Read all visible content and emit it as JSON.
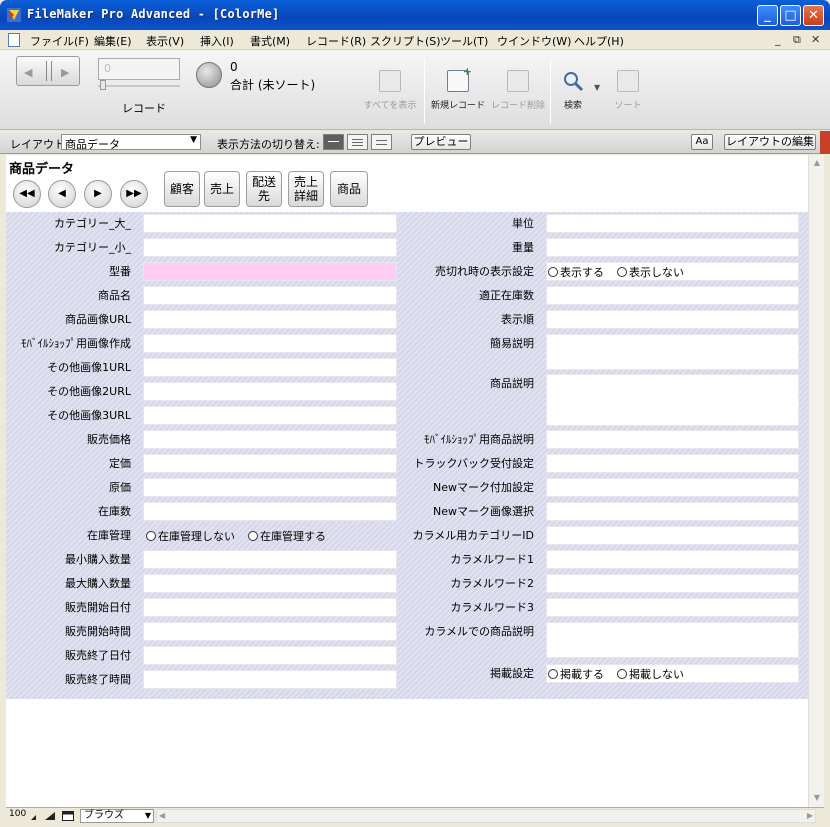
{
  "window": {
    "title": "FileMaker Pro Advanced - [ColorMe]",
    "buttons": {
      "minimize": "_",
      "maximize": "□",
      "close": "✕"
    }
  },
  "menubar": {
    "items": [
      "ファイル(F)",
      "編集(E)",
      "表示(V)",
      "挿入(I)",
      "書式(M)",
      "レコード(R)",
      "スクリプト(S)",
      "ツール(T)",
      "ウインドウ(W)",
      "ヘルプ(H)"
    ],
    "mdi": {
      "minimize": "_",
      "restore": "⧉",
      "close": "✕"
    }
  },
  "toolbar": {
    "record_number": "0",
    "record_label": "レコード",
    "found_count": "0",
    "found_label": "合計 (未ソート)",
    "show_all": "すべてを表示",
    "new_record": "新規レコード",
    "delete_record": "レコード削除",
    "find": "検索",
    "sort": "ソート"
  },
  "layoutbar": {
    "layout_label": "レイアウト:",
    "layout_value": "商品データ",
    "view_as_label": "表示方法の切り替え:",
    "preview": "プレビュー",
    "aa": "Aa",
    "edit_layout": "レイアウトの編集"
  },
  "header": {
    "title": "商品データ",
    "nav_first": "◀◀",
    "nav_prev": "◀",
    "nav_next": "▶",
    "nav_last": "▶▶",
    "btn_customer": "顧客",
    "btn_sales": "売上",
    "btn_delivery": "配送先",
    "btn_sales_detail": "売上詳細",
    "btn_product": "商品"
  },
  "left_fields": [
    "カテゴリー_大_",
    "カテゴリー_小_",
    "型番",
    "商品名",
    "商品画像URL",
    "ﾓﾊﾞｲﾙｼｮｯﾌﾟ用画像作成",
    "その他画像1URL",
    "その他画像2URL",
    "その他画像3URL",
    "販売価格",
    "定価",
    "原価",
    "在庫数",
    "在庫管理",
    "最小購入数量",
    "最大購入数量",
    "販売開始日付",
    "販売開始時間",
    "販売終了日付",
    "販売終了時間"
  ],
  "stock_radio": [
    "在庫管理しない",
    "在庫管理する"
  ],
  "right_fields": {
    "unit": "単位",
    "weight": "重量",
    "soldout": "売切れ時の表示設定",
    "proper_stock": "適正在庫数",
    "display_order": "表示順",
    "short_desc": "簡易説明",
    "desc": "商品説明",
    "mobile_desc": "ﾓﾊﾞｲﾙｼｮｯﾌﾟ用商品説明",
    "trackback": "トラックバック受付設定",
    "newmark": "Newマーク付加設定",
    "newmark_img": "Newマーク画像選択",
    "caramel_cat": "カラメル用カテゴリーID",
    "caramel_w1": "カラメルワード1",
    "caramel_w2": "カラメルワード2",
    "caramel_w3": "カラメルワード3",
    "caramel_desc": "カラメルでの商品説明",
    "publish": "掲載設定"
  },
  "soldout_radio": [
    "表示する",
    "表示しない"
  ],
  "publish_radio": [
    "掲載する",
    "掲載しない"
  ],
  "status": {
    "zoom": "100",
    "mode": "ブラウズ"
  }
}
